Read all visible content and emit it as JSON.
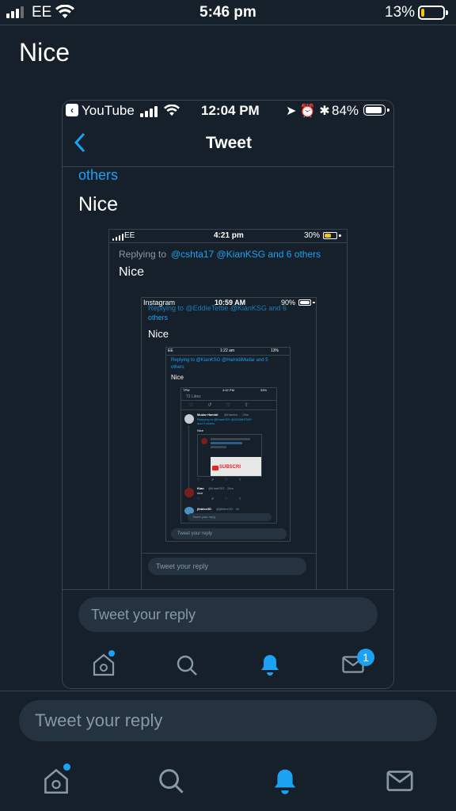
{
  "status": {
    "carrier": "EE",
    "time": "5:46 pm",
    "battery": "13%",
    "battery_level": 0.13
  },
  "tweet": {
    "text": "Nice"
  },
  "screenshot1": {
    "status": {
      "back_app": "YouTube",
      "time": "12:04 PM",
      "battery": "84%"
    },
    "header_title": "Tweet",
    "reply_prefix": "others",
    "text": "Nice",
    "reply_placeholder": "Tweet your reply",
    "nav_badge": "1"
  },
  "screenshot2": {
    "status": {
      "carrier": "EE",
      "time": "4:21 pm",
      "battery": "30%"
    },
    "replying_label": "Replying to",
    "replying_handles": "@cshta17 @KianKSG and 6 others",
    "text": "Nice"
  },
  "screenshot3": {
    "status": {
      "back_app": "Instagram",
      "time": "10:59 AM",
      "battery": "90%"
    },
    "cut_line": "Replying to @EddieTettie @KianKSG and 6",
    "reply_prefix": "others",
    "text": "Nice",
    "reply_placeholder": "Tweet your reply"
  },
  "screenshot4": {
    "status": {
      "carrier": "EE",
      "time": "1:22 am",
      "battery": "13%"
    },
    "replying_line1": "Replying to @KianKSG @HamidiMudar and 5",
    "replying_line2": "others",
    "text": "Nice",
    "reply_placeholder": "Tweet your reply"
  },
  "screenshot5": {
    "status": {
      "carrier": "TPM",
      "time": "4:42 PM",
      "battery": "33%"
    },
    "likes": "72 Likes",
    "reply1": {
      "name": "Mudar Hamidi",
      "meta": "@Hamidi... · 25m",
      "replying": "Replying to @KianKSG @XDSMSTAR and 4 others",
      "text": "Nice"
    },
    "reply2": {
      "name": "Kian",
      "meta": "@KianKSG · 24m",
      "text": "nice"
    },
    "reply3": {
      "name": "jibblezXD",
      "meta": "@jibblezXD · 3h"
    },
    "subscribe": "SUBSCRI",
    "reply_placeholder": "Tweet your reply"
  },
  "bottom": {
    "reply_placeholder": "Tweet your reply"
  },
  "colors": {
    "bg": "#15202b",
    "accent": "#1da1f2",
    "muted": "#8899a6",
    "divider": "#38444d"
  }
}
